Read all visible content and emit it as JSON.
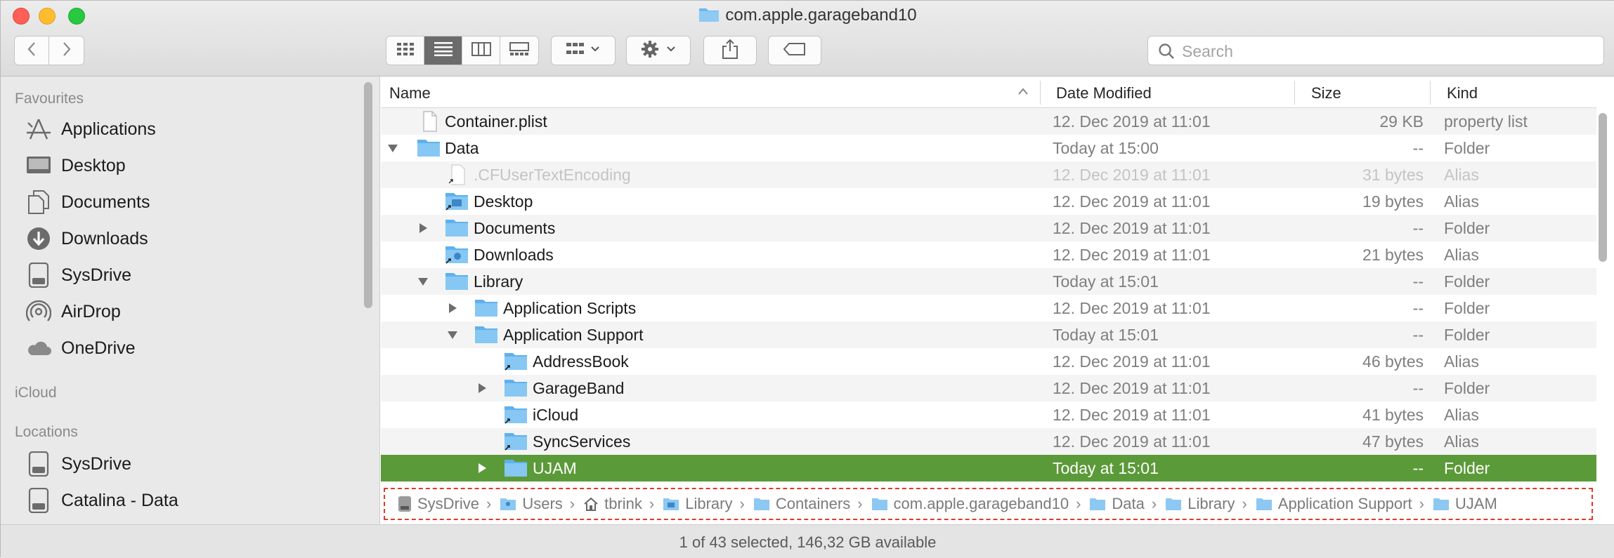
{
  "window": {
    "title": "com.apple.garageband10"
  },
  "toolbar": {
    "back": "back",
    "forward": "forward",
    "views": [
      "icon-view",
      "list-view",
      "column-view",
      "gallery-view"
    ],
    "search_placeholder": "Search"
  },
  "sidebar": {
    "favourites_header": "Favourites",
    "favourites": [
      {
        "label": "Applications",
        "icon": "applications-icon"
      },
      {
        "label": "Desktop",
        "icon": "desktop-icon"
      },
      {
        "label": "Documents",
        "icon": "documents-icon"
      },
      {
        "label": "Downloads",
        "icon": "downloads-icon"
      },
      {
        "label": "SysDrive",
        "icon": "drive-icon"
      },
      {
        "label": "AirDrop",
        "icon": "airdrop-icon"
      },
      {
        "label": "OneDrive",
        "icon": "cloud-icon"
      }
    ],
    "icloud_header": "iCloud",
    "locations_header": "Locations",
    "locations": [
      {
        "label": "SysDrive",
        "icon": "drive-icon"
      },
      {
        "label": "Catalina - Data",
        "icon": "drive-icon"
      }
    ]
  },
  "columns": {
    "name": "Name",
    "date": "Date Modified",
    "size": "Size",
    "kind": "Kind"
  },
  "rows": [
    {
      "name": "Container.plist",
      "date": "12. Dec 2019 at 11:01",
      "size": "29 KB",
      "kind": "property list"
    },
    {
      "name": "Data",
      "date": "Today at 15:00",
      "size": "--",
      "kind": "Folder"
    },
    {
      "name": ".CFUserTextEncoding",
      "date": "12. Dec 2019 at 11:01",
      "size": "31 bytes",
      "kind": "Alias"
    },
    {
      "name": "Desktop",
      "date": "12. Dec 2019 at 11:01",
      "size": "19 bytes",
      "kind": "Alias"
    },
    {
      "name": "Documents",
      "date": "12. Dec 2019 at 11:01",
      "size": "--",
      "kind": "Folder"
    },
    {
      "name": "Downloads",
      "date": "12. Dec 2019 at 11:01",
      "size": "21 bytes",
      "kind": "Alias"
    },
    {
      "name": "Library",
      "date": "Today at 15:01",
      "size": "--",
      "kind": "Folder"
    },
    {
      "name": "Application Scripts",
      "date": "12. Dec 2019 at 11:01",
      "size": "--",
      "kind": "Folder"
    },
    {
      "name": "Application Support",
      "date": "Today at 15:01",
      "size": "--",
      "kind": "Folder"
    },
    {
      "name": "AddressBook",
      "date": "12. Dec 2019 at 11:01",
      "size": "46 bytes",
      "kind": "Alias"
    },
    {
      "name": "GarageBand",
      "date": "12. Dec 2019 at 11:01",
      "size": "--",
      "kind": "Folder"
    },
    {
      "name": "iCloud",
      "date": "12. Dec 2019 at 11:01",
      "size": "41 bytes",
      "kind": "Alias"
    },
    {
      "name": "SyncServices",
      "date": "12. Dec 2019 at 11:01",
      "size": "47 bytes",
      "kind": "Alias"
    },
    {
      "name": "UJAM",
      "date": "Today at 15:01",
      "size": "--",
      "kind": "Folder"
    }
  ],
  "pathbar": [
    "SysDrive",
    "Users",
    "tbrink",
    "Library",
    "Containers",
    "com.apple.garageband10",
    "Data",
    "Library",
    "Application Support",
    "UJAM"
  ],
  "status": {
    "text": "1 of 43 selected, 146,32 GB available"
  },
  "colors": {
    "selection": "#5b9a38",
    "folder": "#6cb8ef",
    "highlight_border": "#e03a2a"
  }
}
